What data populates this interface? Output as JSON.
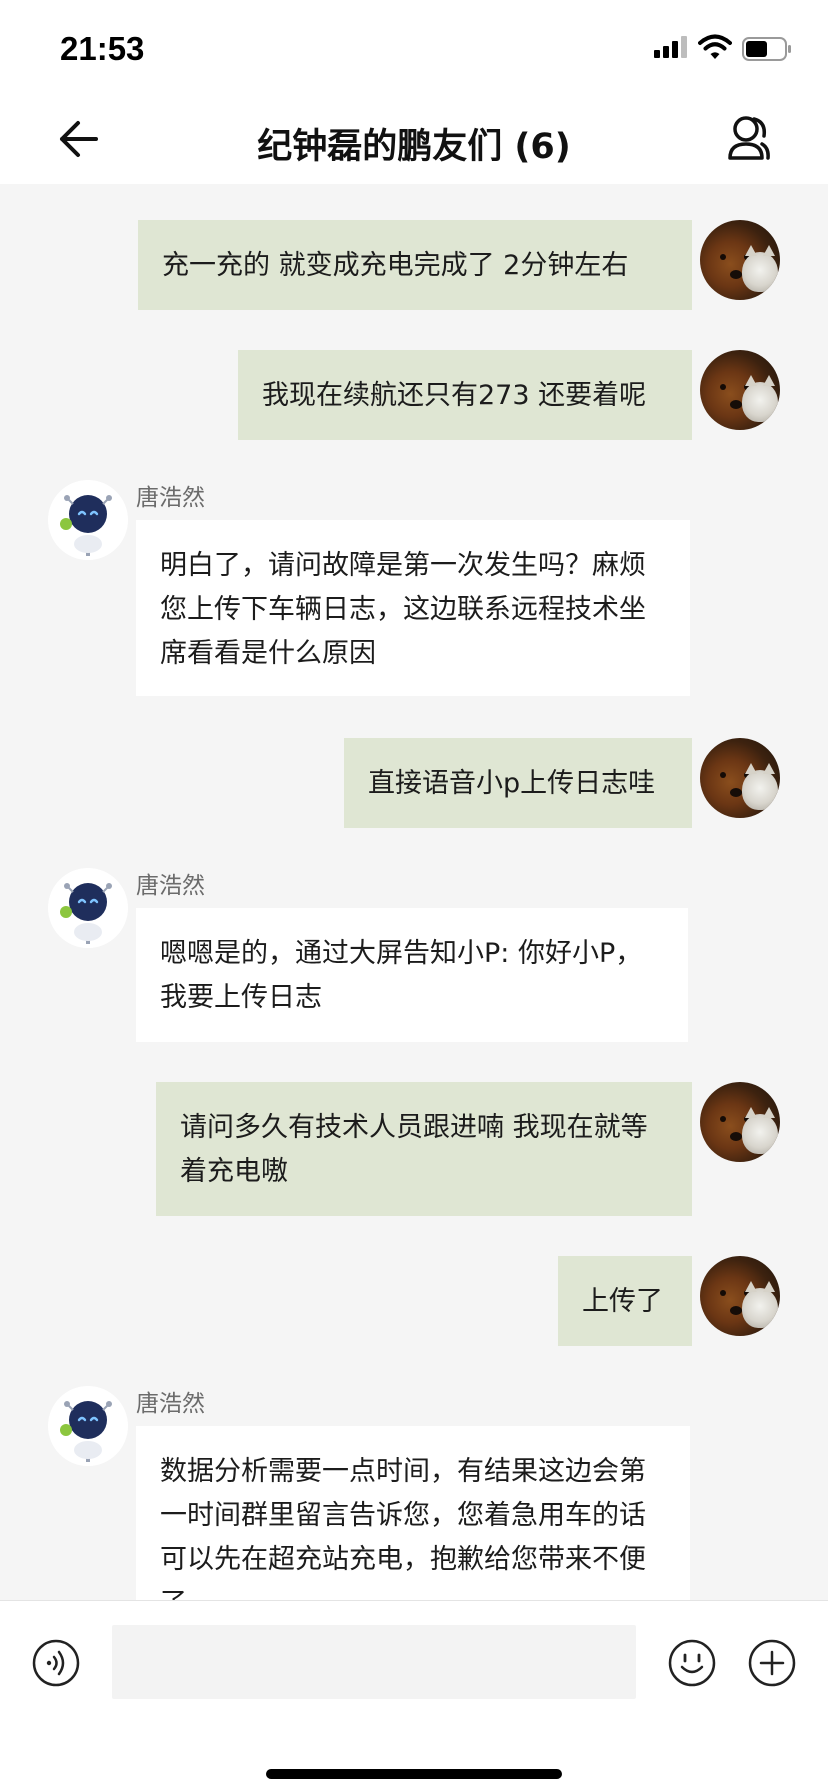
{
  "status_bar": {
    "time": "21:53"
  },
  "header": {
    "title": "纪钟磊的鹏友们 (6)"
  },
  "messages": [
    {
      "side": "out",
      "text": "充一充的  就变成充电完成了  2分钟左右"
    },
    {
      "side": "out",
      "text": "我现在续航还只有273  还要着呢"
    },
    {
      "side": "in",
      "sender": "唐浩然",
      "text": "明白了，请问故障是第一次发生吗？麻烦您上传下车辆日志，这边联系远程技术坐席看看是什么原因"
    },
    {
      "side": "out",
      "text": "直接语音小p上传日志哇"
    },
    {
      "side": "in",
      "sender": "唐浩然",
      "text": "嗯嗯是的，通过大屏告知小P: 你好小P，我要上传日志"
    },
    {
      "side": "out",
      "text": "请问多久有技术人员跟进喃 我现在就等着充电嗷"
    },
    {
      "side": "out",
      "text": "上传了"
    },
    {
      "side": "in",
      "sender": "唐浩然",
      "text": "数据分析需要一点时间，有结果这边会第一时间群里留言告诉您，您着急用车的话可以先在超充站充电，抱歉给您带来不便了"
    }
  ],
  "input_bar": {
    "value": ""
  },
  "icons": {
    "back": "arrow-left-icon",
    "group": "group-members-icon",
    "voice": "voice-icon",
    "emoji": "emoji-icon",
    "more": "plus-icon"
  },
  "colors": {
    "outgoing_bubble": "#dfe6d3",
    "incoming_bubble": "#ffffff",
    "chat_background": "#f5f5f5"
  }
}
